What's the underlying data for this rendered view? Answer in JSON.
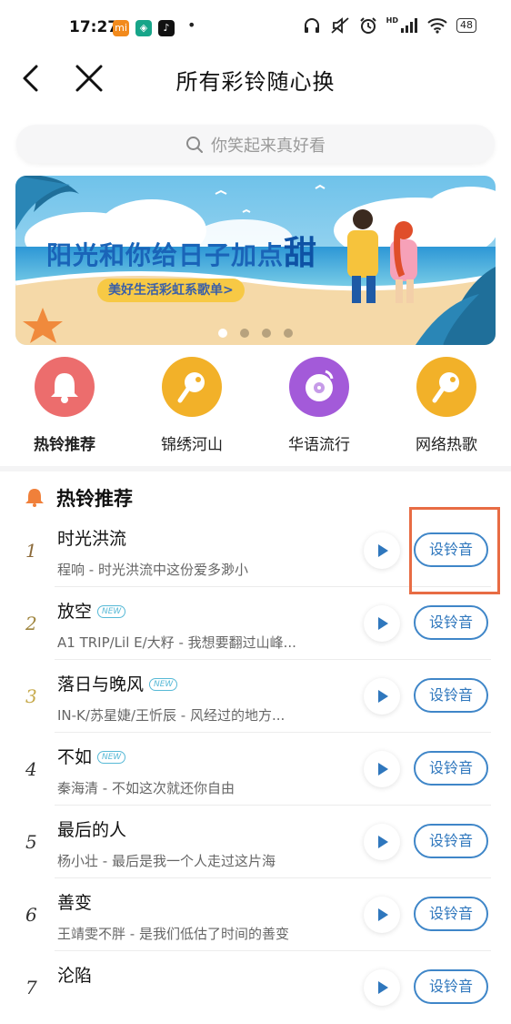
{
  "status_bar": {
    "time": "17:27",
    "apps": [
      {
        "name": "mi-app-icon",
        "glyph": "mi",
        "color": "#f28a1c"
      },
      {
        "name": "mobile-app-icon",
        "glyph": "◈",
        "color": "#17a589"
      },
      {
        "name": "tiktok-icon",
        "glyph": "♪",
        "color": "#111111"
      }
    ],
    "dot": "•",
    "battery": "48",
    "signal_label": "HD"
  },
  "nav": {
    "title": "所有彩铃随心换",
    "back_icon": "chevron-left-icon",
    "close_icon": "close-icon"
  },
  "search": {
    "placeholder": "你笑起来真好看",
    "icon": "search-icon"
  },
  "banner": {
    "title_main": "阳光和你给日子加点",
    "title_accent": "甜",
    "subtitle": "美好生活彩虹系歌单>",
    "dots_total": 4,
    "dots_active_index": 0
  },
  "categories": [
    {
      "label": "热铃推荐",
      "icon": "bell-icon",
      "color": "#ec6d6d",
      "bold": true
    },
    {
      "label": "锦绣河山",
      "icon": "ringtone-icon",
      "color": "#f2b129",
      "bold": false
    },
    {
      "label": "华语流行",
      "icon": "vinyl-icon",
      "color": "#a35ad9",
      "bold": false
    },
    {
      "label": "网络热歌",
      "icon": "ringtone-icon",
      "color": "#f2b129",
      "bold": false
    }
  ],
  "section": {
    "title": "热铃推荐",
    "icon": "bell-icon"
  },
  "set_button_label": "设铃音",
  "new_tag_label": "NEW",
  "rank_colors": [
    "#8b6a3a",
    "#a08640",
    "#c6a94a",
    "#333333",
    "#333333",
    "#333333",
    "#333333"
  ],
  "songs": [
    {
      "rank": "1",
      "title": "时光洪流",
      "desc": "程响 - 时光洪流中这份爱多渺小",
      "is_new": false
    },
    {
      "rank": "2",
      "title": "放空",
      "desc": "A1 TRIP/Lil E/大籽 - 我想要翻过山峰...",
      "is_new": true
    },
    {
      "rank": "3",
      "title": "落日与晚风",
      "desc": "IN-K/苏星婕/王忻辰 - 风经过的地方...",
      "is_new": true
    },
    {
      "rank": "4",
      "title": "不如",
      "desc": "秦海清 - 不如这次就还你自由",
      "is_new": true
    },
    {
      "rank": "5",
      "title": "最后的人",
      "desc": "杨小壮 - 最后是我一个人走过这片海",
      "is_new": false
    },
    {
      "rank": "6",
      "title": "善变",
      "desc": "王靖雯不胖 - 是我们低估了时间的善变",
      "is_new": false
    },
    {
      "rank": "7",
      "title": "沦陷",
      "desc": "",
      "is_new": false
    }
  ],
  "colors": {
    "accent_blue": "#2f77bd",
    "highlight_box": "#e86c44"
  }
}
